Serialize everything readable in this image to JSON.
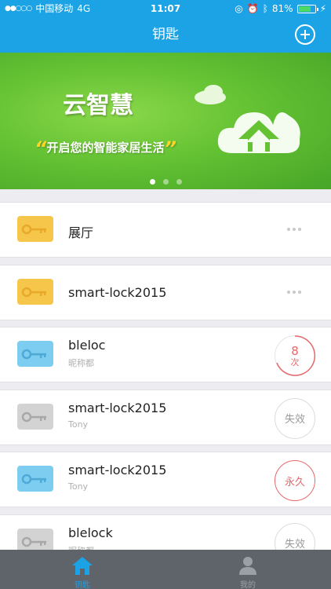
{
  "status_bar": {
    "carrier": "中国移动",
    "network": "4G",
    "time": "11:07",
    "battery_pct": "81%",
    "battery_level": 0.81
  },
  "nav": {
    "title": "钥匙",
    "add_icon": "plus-circle-icon"
  },
  "banner": {
    "title": "云智慧",
    "slogan": "开启您的智能家居生活",
    "open_quote": "“",
    "close_quote": "”",
    "page_count": 3,
    "active_page": 1
  },
  "keys": [
    {
      "name": "展厅",
      "subtitle": "",
      "color": "yellow",
      "status": {
        "type": "more"
      }
    },
    {
      "name": "smart-lock2015",
      "subtitle": "",
      "color": "yellow",
      "status": {
        "type": "more"
      }
    },
    {
      "name": "bleloc",
      "subtitle": "昵称都",
      "color": "blue",
      "status": {
        "type": "count",
        "value": "8",
        "unit": "次"
      }
    },
    {
      "name": "smart-lock2015",
      "subtitle": "Tony",
      "color": "gray",
      "status": {
        "type": "expired",
        "label": "失效"
      }
    },
    {
      "name": "smart-lock2015",
      "subtitle": "Tony",
      "color": "blue",
      "status": {
        "type": "forever",
        "label": "永久"
      }
    },
    {
      "name": "blelock",
      "subtitle": "昵称都",
      "color": "gray",
      "status": {
        "type": "expired",
        "label": "失效"
      }
    }
  ],
  "tabbar": {
    "tabs": [
      {
        "label": "钥匙",
        "icon": "home-icon",
        "active": true
      },
      {
        "label": "我的",
        "icon": "person-icon",
        "active": false
      }
    ]
  },
  "colors": {
    "primary": "#1ba3e6",
    "accent_red": "#e6676b",
    "banner_green": "#64c233"
  }
}
